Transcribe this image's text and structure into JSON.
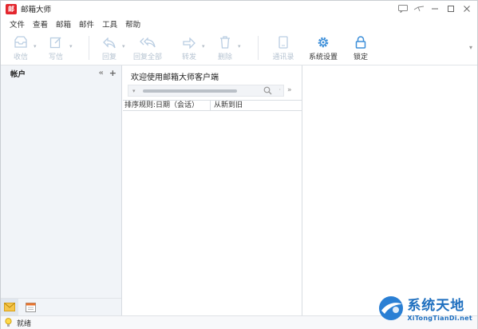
{
  "window": {
    "title": "邮箱大师",
    "logo_text": "邮"
  },
  "menu": {
    "items": [
      "文件",
      "查看",
      "邮箱",
      "邮件",
      "工具",
      "帮助"
    ]
  },
  "toolbar": {
    "items": [
      {
        "label": "收信",
        "icon": "inbox-icon",
        "enabled": false
      },
      {
        "label": "写信",
        "icon": "compose-icon",
        "enabled": false
      },
      {
        "label": "回复",
        "icon": "reply-icon",
        "enabled": false
      },
      {
        "label": "回复全部",
        "icon": "reply-all-icon",
        "enabled": false
      },
      {
        "label": "转发",
        "icon": "forward-icon",
        "enabled": false
      },
      {
        "label": "删除",
        "icon": "trash-icon",
        "enabled": false
      },
      {
        "label": "通讯录",
        "icon": "contacts-icon",
        "enabled": false
      },
      {
        "label": "系统设置",
        "icon": "gear-icon",
        "enabled": true
      },
      {
        "label": "锁定",
        "icon": "lock-icon",
        "enabled": true
      }
    ]
  },
  "sidebar": {
    "title": "帐户"
  },
  "message_list": {
    "title": "欢迎使用邮箱大师客户端",
    "search": {
      "value": "",
      "placeholder": ""
    },
    "columns": [
      "排序规则:日期（会话）",
      "从新到旧"
    ]
  },
  "status": {
    "text": "就绪"
  },
  "watermark": {
    "cn": "系统天地",
    "en": "XiTongTianDi.net"
  },
  "colors": {
    "brand_red": "#e3262d",
    "accent_blue": "#3d8fd9",
    "disabled": "#b7c4d2"
  }
}
